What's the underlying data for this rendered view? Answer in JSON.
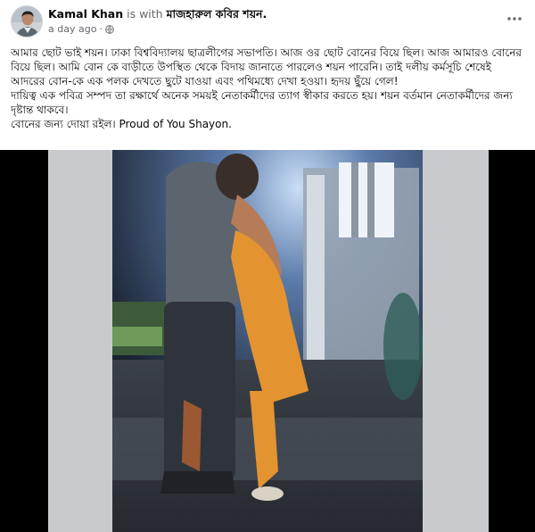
{
  "post": {
    "author": "Kamal Khan",
    "with_text": "is with",
    "tagged_user": "মাজহারুল কবির শয়ন.",
    "timestamp": "a day ago",
    "privacy_icon": "globe-icon",
    "more_icon": "more-horizontal-icon",
    "lines": [
      "আমার ছোট ভাই শয়ন। ঢাকা বিশ্ববিদ্যালয় ছাত্রলীগের সভাপতি। আজ ওর ছোট বোনের বিয়ে ছিল। আজ আমারও বোনের",
      "বিয়ে ছিল। আমি বোন কে বাড়ীতে উপস্থিত থেকে বিদায় জানাতে পারলেও শয়ন পারেনি। তাই দলীয় কর্মসূচি শেষেই",
      "আদরের বোন-কে এক পলক দেখতে ছুটে যাওয়া এবং পথিমধ্যে দেখা হওয়া। হৃদয় ছুঁয়ে গেল!",
      "দায়িত্ব এক পবিত্র সম্পদ তা রক্ষার্থে অনেক সময়ই নেতাকর্মীদের ত্যাগ স্বীকার করতে হয়। শয়ন বর্তমান নেতাকর্মীদের জন্য",
      "দৃষ্টান্ত থাকবে।",
      "বোনের জন্য দোয়া রইল। Proud of You Shayon."
    ]
  },
  "colors": {
    "text_primary": "#050505",
    "text_secondary": "#65676b",
    "media_letterbox": "#000000",
    "video_frame": "#c8cacd",
    "night_sky": "#1a2230",
    "light_glow": "#aecbf0",
    "orange_dress": "#e39431"
  }
}
